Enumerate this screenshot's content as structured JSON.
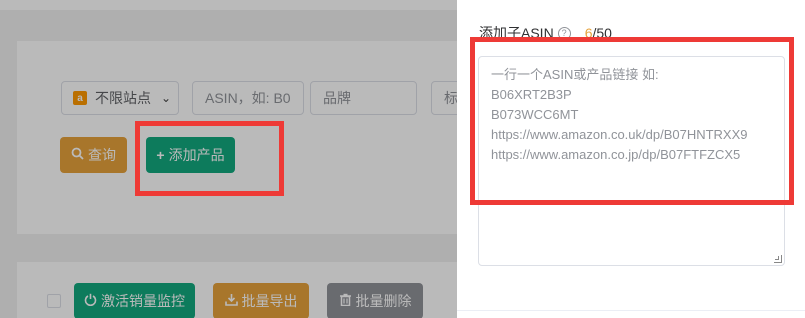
{
  "filters": {
    "site_value": "不限站点",
    "site_badge": "a",
    "asin_placeholder": "ASIN，如: B0",
    "brand_placeholder": "品牌",
    "tag_placeholder": "标"
  },
  "actions": {
    "query_label": "查询",
    "add_product_label": "添加产品"
  },
  "list_toolbar": {
    "activate_label": "激活销量监控",
    "export_label": "批量导出",
    "delete_label": "批量删除"
  },
  "drawer": {
    "label": "添加子ASIN",
    "count_current": "6",
    "count_max": "/50",
    "textarea_placeholder_lines": [
      "一行一个ASIN或产品链接 如:",
      "B06XRT2B3P",
      "B073WCC6MT",
      "https://www.amazon.co.uk/dp/B07HNTRXX9",
      "https://www.amazon.co.jp/dp/B07FTFZCX5"
    ]
  },
  "colors": {
    "primary_green": "#13a97f",
    "warning_orange": "#e6a23c",
    "info_gray": "#909399",
    "annotation_red": "#ee3a36"
  },
  "icons": {
    "query": "search-icon",
    "add": "plus-icon",
    "activate": "power-icon",
    "export": "download-icon",
    "delete": "trash-icon",
    "help": "question-circle-icon"
  }
}
